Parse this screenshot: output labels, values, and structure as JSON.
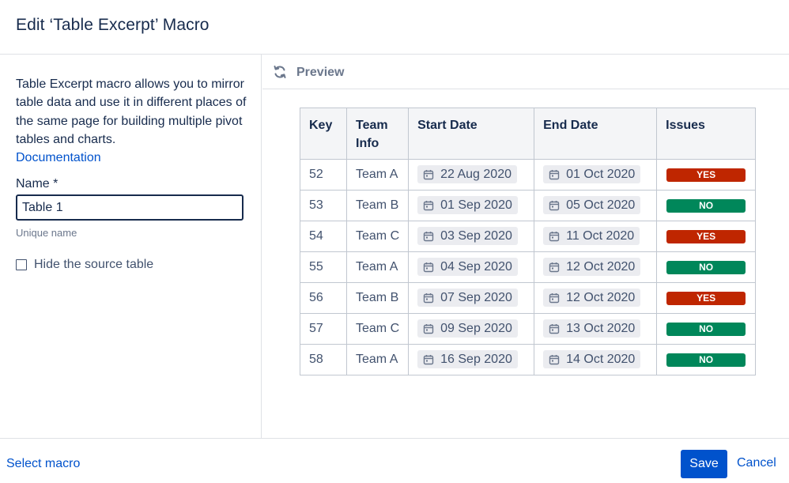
{
  "dialog": {
    "title": "Edit ‘Table Excerpt’ Macro"
  },
  "sidebar": {
    "description": "Table Excerpt macro allows you to mirror table data and use it in different places of the same page for building multiple pivot tables and charts.",
    "doc_link": "Documentation",
    "name_label": "Name *",
    "name_value": "Table 1",
    "name_hint": "Unique name",
    "hide_label": "Hide the source table"
  },
  "preview": {
    "label": "Preview",
    "columns": [
      "Key",
      "Team Info",
      "Start Date",
      "End Date",
      "Issues"
    ],
    "rows": [
      {
        "key": "52",
        "team": "Team A",
        "start": "22 Aug 2020",
        "end": "01 Oct 2020",
        "issue": "YES"
      },
      {
        "key": "53",
        "team": "Team B",
        "start": "01 Sep 2020",
        "end": "05 Oct 2020",
        "issue": "NO"
      },
      {
        "key": "54",
        "team": "Team C",
        "start": "03 Sep 2020",
        "end": "11 Oct 2020",
        "issue": "YES"
      },
      {
        "key": "55",
        "team": "Team A",
        "start": "04 Sep 2020",
        "end": "12 Oct 2020",
        "issue": "NO"
      },
      {
        "key": "56",
        "team": "Team B",
        "start": "07 Sep 2020",
        "end": "12 Oct 2020",
        "issue": "YES"
      },
      {
        "key": "57",
        "team": "Team C",
        "start": "09 Sep 2020",
        "end": "13 Oct 2020",
        "issue": "NO"
      },
      {
        "key": "58",
        "team": "Team A",
        "start": "16 Sep 2020",
        "end": "14 Oct 2020",
        "issue": "NO"
      }
    ]
  },
  "colors": {
    "yes": "#bf2600",
    "no": "#00875a",
    "accent": "#0052cc"
  },
  "footer": {
    "select_macro": "Select macro",
    "save": "Save",
    "cancel": "Cancel"
  }
}
